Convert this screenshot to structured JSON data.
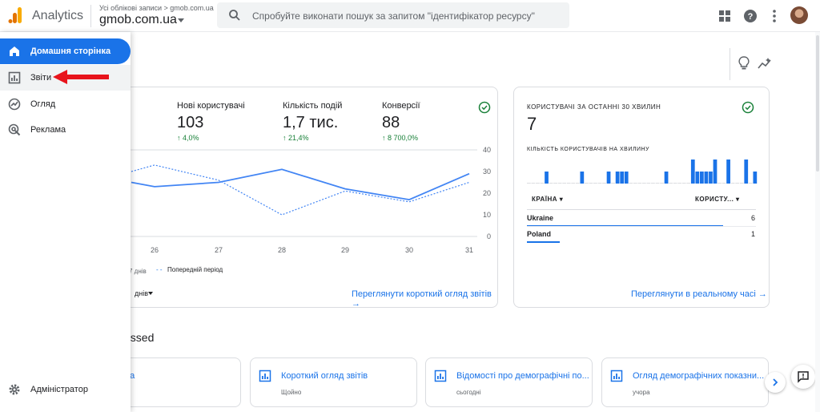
{
  "colors": {
    "accent": "#1a73e8",
    "positive": "#188038",
    "arrow": "#e8141c"
  },
  "header": {
    "app_name": "Analytics",
    "breadcrumb": "Усі облікові записи > gmob.com.ua",
    "property": "gmob.com.ua",
    "search_placeholder": "Спробуйте виконати пошук за запитом \"ідентифікатор ресурсу\""
  },
  "sidebar": {
    "items": [
      {
        "label": "Домашня сторінка",
        "icon": "home-icon"
      },
      {
        "label": "Звіти",
        "icon": "bar-chart-icon"
      },
      {
        "label": "Огляд",
        "icon": "explore-icon"
      },
      {
        "label": "Реклама",
        "icon": "ads-icon"
      }
    ],
    "admin": {
      "label": "Адміністратор",
      "icon": "gear-icon"
    }
  },
  "overview": {
    "metrics": [
      {
        "label": "Нові користувачі",
        "value": "103",
        "delta": "4,0%"
      },
      {
        "label": "Кількість подій",
        "value": "1,7 тис.",
        "delta": "21,4%"
      },
      {
        "label": "Конверсії",
        "value": "88",
        "delta": "8 700,0%"
      }
    ],
    "legend_current": "7 днів",
    "legend_previous": "Попередній період",
    "range_label": "днів",
    "link": "Переглянути короткий огляд звітів"
  },
  "chart_data": {
    "type": "line",
    "x": [
      "26",
      "27",
      "28",
      "29",
      "30",
      "31"
    ],
    "yticks": [
      "40",
      "30",
      "20",
      "10",
      "0"
    ],
    "ylim": [
      0,
      40
    ],
    "series": [
      {
        "values": [
          25,
          23,
          25,
          31,
          22,
          17,
          29
        ]
      },
      {
        "values": [
          30,
          33,
          26,
          10,
          21,
          16,
          25
        ]
      }
    ]
  },
  "realtime": {
    "title": "КОРИСТУВАЧІ ЗА ОСТАННІ 30 ХВИЛИН",
    "value": "7",
    "subtitle": "КІЛЬКІСТЬ КОРИСТУВАЧІВ НА ХВИЛИНУ",
    "col_country": "КРАЇНА",
    "col_users": "КОРИСТУ...",
    "rows": [
      {
        "country": "Ukraine",
        "users": "6"
      },
      {
        "country": "Poland",
        "users": "1"
      }
    ],
    "bars": [
      0,
      0,
      0,
      0,
      1,
      0,
      0,
      0,
      0,
      0,
      0,
      0,
      1,
      0,
      0,
      0,
      0,
      0,
      1,
      0,
      1,
      1,
      1,
      0,
      0,
      0,
      0,
      0,
      0,
      0,
      0,
      1,
      0,
      0,
      0,
      0,
      0,
      2,
      1,
      1,
      1,
      1,
      2,
      0,
      0,
      2,
      0,
      0,
      0,
      2,
      0,
      1
    ],
    "link": "Переглянути в реальному часі"
  },
  "recent": {
    "title": "cessed",
    "cards": [
      {
        "title": "ека",
        "sub": ""
      },
      {
        "title": "Короткий огляд звітів",
        "sub": "Щойно"
      },
      {
        "title": "Відомості про демографічні по...",
        "sub": "сьогодні"
      },
      {
        "title": "Огляд демографічних показни...",
        "sub": "учора"
      }
    ]
  }
}
